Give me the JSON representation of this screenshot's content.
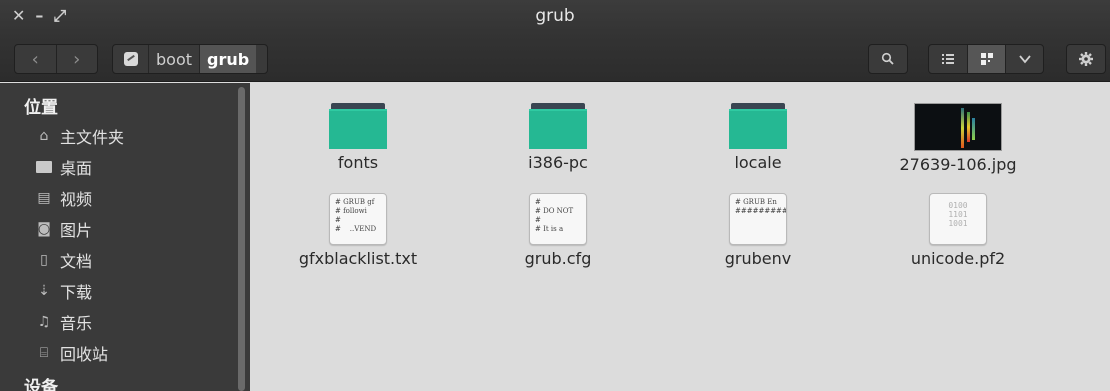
{
  "window": {
    "title": "grub",
    "controls": [
      "close-icon",
      "minimize-icon",
      "maximize-icon"
    ]
  },
  "toolbar": {
    "back_icon": "‹",
    "forward_icon": "›",
    "path": [
      "boot",
      "grub"
    ],
    "search_icon": "search-icon",
    "view_list_icon": "list-view-icon",
    "view_grid_icon": "grid-view-icon",
    "view_menu_icon": "chevron-down-icon",
    "settings_icon": "gear-icon"
  },
  "sidebar": {
    "heading_places": "位置",
    "items": [
      {
        "label": "主文件夹",
        "icon": "home-icon"
      },
      {
        "label": "桌面",
        "icon": "folder-icon"
      },
      {
        "label": "视频",
        "icon": "video-icon"
      },
      {
        "label": "图片",
        "icon": "camera-icon"
      },
      {
        "label": "文档",
        "icon": "document-icon"
      },
      {
        "label": "下载",
        "icon": "download-icon"
      },
      {
        "label": "音乐",
        "icon": "music-icon"
      },
      {
        "label": "回收站",
        "icon": "trash-icon"
      }
    ],
    "heading_devices": "设备"
  },
  "files": [
    {
      "name": "fonts",
      "type": "folder"
    },
    {
      "name": "i386-pc",
      "type": "folder"
    },
    {
      "name": "locale",
      "type": "folder"
    },
    {
      "name": "27639-106.jpg",
      "type": "image"
    },
    {
      "name": "gfxblacklist.txt",
      "type": "text",
      "preview": "# GRUB gf\n# followi\n#\n#    ..VEND"
    },
    {
      "name": "grub.cfg",
      "type": "text",
      "preview": "#\n# DO NOT\n#\n# It is a"
    },
    {
      "name": "grubenv",
      "type": "text",
      "preview": "# GRUB En\n##########"
    },
    {
      "name": "unicode.pf2",
      "type": "binary",
      "preview": "0100\n1101\n1001"
    }
  ],
  "colors": {
    "folder": "#25b893",
    "sidebar": "#3a3a3a",
    "titlebar": "#333333",
    "content_bg": "#dcdcdc"
  }
}
